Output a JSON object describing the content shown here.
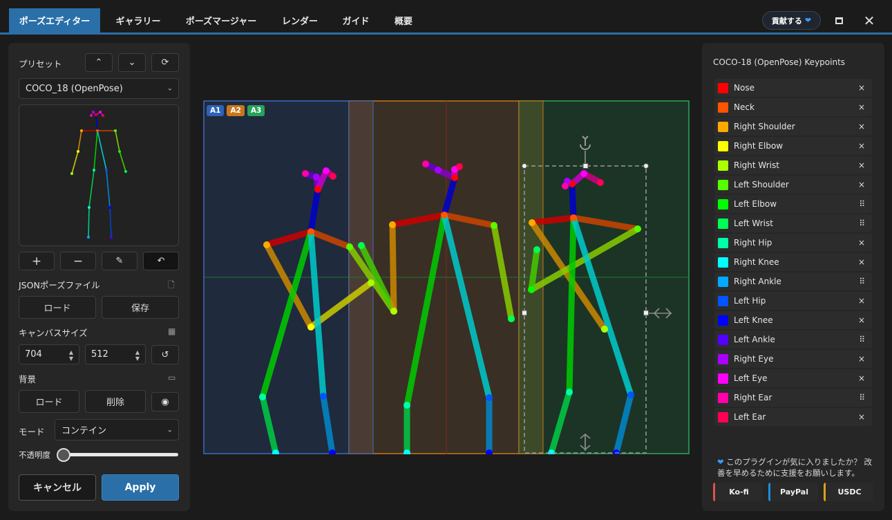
{
  "tabs": [
    {
      "label": "ポーズエディター",
      "active": true
    },
    {
      "label": "ギャラリー",
      "active": false
    },
    {
      "label": "ポーズマージャー",
      "active": false
    },
    {
      "label": "レンダー",
      "active": false
    },
    {
      "label": "ガイド",
      "active": false
    },
    {
      "label": "概要",
      "active": false
    }
  ],
  "header": {
    "donate_label": "貢献する",
    "donate_icon": "heart-icon",
    "maximize_icon": "square-icon",
    "close_icon": "close-icon"
  },
  "left_panel": {
    "preset_label": "プリセット",
    "preset_value": "COCO_18 (OpenPose)",
    "json_label": "JSONポーズファイル",
    "load_label": "ロード",
    "save_label": "保存",
    "canvas_size_label": "キャンバスサイズ",
    "width": "704",
    "height": "512",
    "background_label": "背景",
    "bg_load_label": "ロード",
    "bg_delete_label": "削除",
    "mode_label": "モード",
    "mode_value": "コンテイン",
    "opacity_label": "不透明度",
    "opacity_value": 0,
    "cancel_label": "キャンセル",
    "apply_label": "Apply"
  },
  "canvas": {
    "badges": [
      {
        "label": "A1",
        "color": "#2f62b8"
      },
      {
        "label": "A2",
        "color": "#c8781a"
      },
      {
        "label": "A3",
        "color": "#27a35a"
      }
    ]
  },
  "right_panel": {
    "title": "COCO-18 (OpenPose) Keypoints",
    "keypoints": [
      {
        "name": "Nose",
        "color": "#ff0000",
        "action": "×"
      },
      {
        "name": "Neck",
        "color": "#ff5500",
        "action": "×"
      },
      {
        "name": "Right Shoulder",
        "color": "#ffaa00",
        "action": "×"
      },
      {
        "name": "Right Elbow",
        "color": "#ffff00",
        "action": "×"
      },
      {
        "name": "Right Wrist",
        "color": "#aaff00",
        "action": "×"
      },
      {
        "name": "Left Shoulder",
        "color": "#55ff00",
        "action": "×"
      },
      {
        "name": "Left Elbow",
        "color": "#00ff00",
        "action": "⠿"
      },
      {
        "name": "Left Wrist",
        "color": "#00ff55",
        "action": "⠿"
      },
      {
        "name": "Right Hip",
        "color": "#00ffaa",
        "action": "×"
      },
      {
        "name": "Right Knee",
        "color": "#00ffff",
        "action": "×"
      },
      {
        "name": "Right Ankle",
        "color": "#00aaff",
        "action": "⠿"
      },
      {
        "name": "Left Hip",
        "color": "#0055ff",
        "action": "×"
      },
      {
        "name": "Left Knee",
        "color": "#0000ff",
        "action": "×"
      },
      {
        "name": "Left Ankle",
        "color": "#5500ff",
        "action": "⠿"
      },
      {
        "name": "Right Eye",
        "color": "#aa00ff",
        "action": "×"
      },
      {
        "name": "Left Eye",
        "color": "#ff00ff",
        "action": "×"
      },
      {
        "name": "Right Ear",
        "color": "#ff00aa",
        "action": "⠿"
      },
      {
        "name": "Left Ear",
        "color": "#ff0055",
        "action": "×"
      }
    ],
    "support_text": "このプラグインが気に入りましたか？ 改善を早めるために支援をお願いします。",
    "links": [
      {
        "label": "Ko-fi",
        "color": "#e0524f"
      },
      {
        "label": "PayPal",
        "color": "#1a8fe0"
      },
      {
        "label": "USDC",
        "color": "#d9a21c"
      }
    ]
  }
}
